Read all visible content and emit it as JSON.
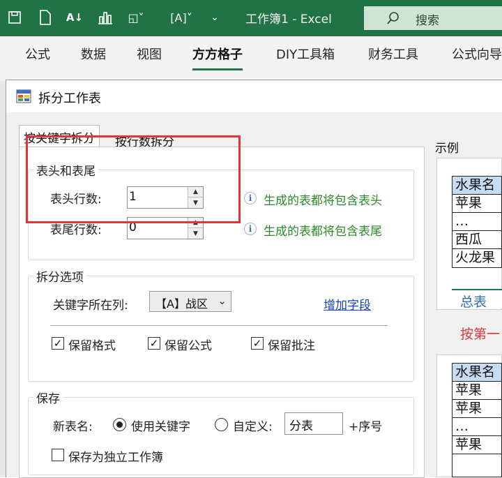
{
  "titlebar": {
    "window_title": "工作簿1 - Excel",
    "search_label": "搜索"
  },
  "ribbon_tabs": [
    "公式",
    "数据",
    "视图",
    "方方格子",
    "DIY工具箱",
    "财务工具",
    "公式向导"
  ],
  "dialog": {
    "title": "拆分工作表",
    "tabs": [
      "按关键字拆分",
      "按行数拆分"
    ],
    "header_footer": {
      "group_title": "表头和表尾",
      "header_rows_label": "表头行数:",
      "header_rows_value": "1",
      "header_hint": "生成的表都将包含表头",
      "footer_rows_label": "表尾行数:",
      "footer_rows_value": "0",
      "footer_hint": "生成的表都将包含表尾"
    },
    "split_options": {
      "group_title": "拆分选项",
      "keyword_col_label": "关键字所在列:",
      "keyword_col_value": "【A】战区",
      "add_field_link": "增加字段",
      "keep_format": "保留格式",
      "keep_formula": "保留公式",
      "keep_comment": "保留批注"
    },
    "save": {
      "group_title": "保存",
      "new_name_label": "新表名:",
      "use_keyword": "使用关键字",
      "custom": "自定义:",
      "custom_value": "分表",
      "seq_suffix": "+序号",
      "save_independent": "保存为独立工作簿"
    },
    "example": {
      "label": "示例",
      "table1": [
        "水果名",
        "苹果",
        "…",
        "西瓜",
        "火龙果"
      ],
      "sheet_tab": "总表",
      "caption": "按第一",
      "table2": [
        "水果名",
        "苹果",
        "苹果",
        "…",
        "苹果"
      ]
    }
  },
  "colors": {
    "excel_green": "#217346",
    "highlight_red": "#e0363a",
    "hint_green": "#2a8a2a",
    "link_blue": "#1a3fbf"
  }
}
